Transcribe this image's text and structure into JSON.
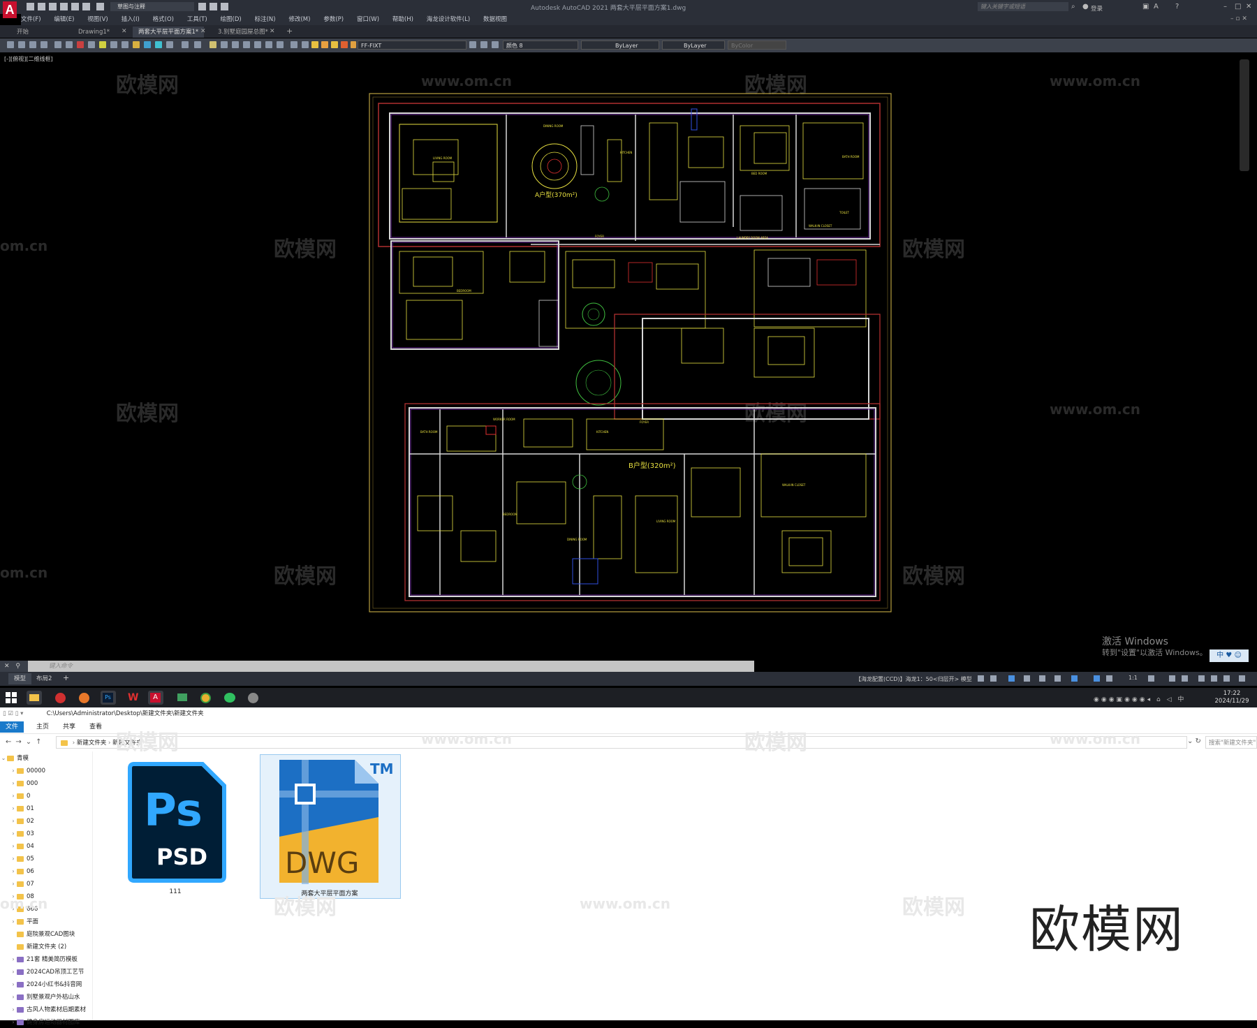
{
  "acad": {
    "logo": "A",
    "workspace": "草图与注释",
    "title": "Autodesk AutoCAD 2021    两套大平层平面方案1.dwg",
    "search_placeholder": "键入关键字或短语",
    "login": "登录",
    "menu": [
      "文件(F)",
      "编辑(E)",
      "视图(V)",
      "插入(I)",
      "格式(O)",
      "工具(T)",
      "绘图(D)",
      "标注(N)",
      "修改(M)",
      "参数(P)",
      "窗口(W)",
      "帮助(H)",
      "海龙设计软件(L)",
      "数据视图"
    ],
    "tabs": [
      {
        "label": "开始"
      },
      {
        "label": "Drawing1*"
      },
      {
        "label": "两套大平层平面方案1*"
      },
      {
        "label": "3.别墅庭园屋总图*"
      }
    ],
    "toolbar": {
      "layer": "FF-FIXT",
      "color": "颜色 8",
      "linetype": "ByLayer",
      "lineweight": "ByLayer",
      "plotstyle": "ByColor"
    },
    "viewport_label": "[-][俯视][二维线框]",
    "command_placeholder": "键入命令",
    "layout_tabs": [
      "模型",
      "布局2"
    ],
    "status_text": "【海龙配置(CCD)】海龙1：50<归层开>  模型",
    "scale": "1:1"
  },
  "drawing": {
    "unit_a_label": "A户型(370m²)",
    "unit_b_label": "B户型(320m²)",
    "rooms_a": [
      "LIVING ROOM",
      "DINING ROOM",
      "KITCHEN",
      "BED ROOM",
      "BATH ROOM",
      "WALK-IN CLOSET",
      "FOYER",
      "LAUNDRY ROOM AREA",
      "TOILET",
      "BEDROOM"
    ],
    "rooms_b": [
      "BATH ROOM",
      "BEDROOM",
      "WALK-IN CLOSET",
      "FOYER",
      "LIVING ROOM",
      "DINING ROOM",
      "KITCHEN",
      "WORKER ROOM"
    ]
  },
  "watermarks": {
    "cn": "欧模网",
    "url": "www.om.cn",
    "partial": "om.cn"
  },
  "windows": {
    "activate_title": "激活 Windows",
    "activate_sub": "转到\"设置\"以激活 Windows。",
    "ime": "中 ♥ ☺",
    "time": "17:22",
    "date": "2024/11/29"
  },
  "explorer": {
    "path_title": "C:\\Users\\Administrator\\Desktop\\新建文件夹\\新建文件夹",
    "ribbon_tabs": [
      "文件",
      "主页",
      "共享",
      "查看"
    ],
    "breadcrumb": [
      "新建文件夹",
      "新建文件夹"
    ],
    "search_placeholder": "搜索\"新建文件夹\"",
    "tree_root": "青模",
    "tree": [
      "00000",
      "000",
      "0",
      "01",
      "02",
      "03",
      "04",
      "05",
      "06",
      "07",
      "08",
      "666",
      "平面",
      "庭院景观CAD图块",
      "新建文件夹 (2)",
      "21套 精美简历模板",
      "2024CAD吊顶工艺节",
      "2024小红书&抖音网",
      "别墅景观户外枯山水",
      "古风人物素材后期素材",
      "健身房运动器材图库"
    ],
    "files": [
      {
        "name": "111",
        "icon_text": "Ps",
        "icon_sub": "PSD"
      },
      {
        "name": "两套大平层平面方案",
        "icon_text": "DWG",
        "icon_tm": "TM"
      }
    ],
    "brand": "欧模网"
  },
  "colors": {
    "acad_bg": "#000000",
    "wall": "#d8d8d8",
    "accent_red": "#e03030",
    "accent_yellow": "#e8e040",
    "accent_purple": "#7030a0",
    "ps_blue": "#31a8ff",
    "dwg_yellow": "#f2b22e",
    "dwg_blue": "#1c6fc4"
  }
}
